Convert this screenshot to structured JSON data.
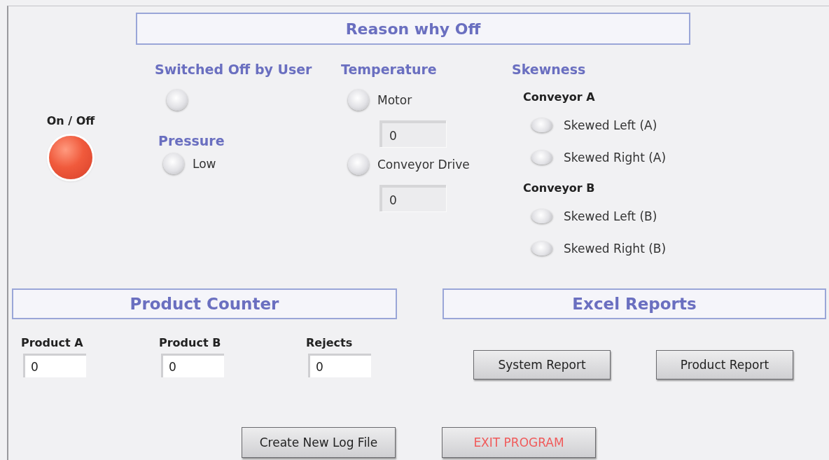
{
  "header": {
    "title": "Reason why Off"
  },
  "power": {
    "label": "On / Off",
    "on": true
  },
  "user_off": {
    "title": "Switched Off by User",
    "indicator": {
      "on": false
    }
  },
  "pressure": {
    "title": "Pressure",
    "indicators": [
      {
        "label": "Low",
        "on": false
      }
    ]
  },
  "temperature": {
    "title": "Temperature",
    "sensors": [
      {
        "label": "Motor",
        "on": false,
        "value": "0"
      },
      {
        "label": "Conveyor Drive",
        "on": false,
        "value": "0"
      }
    ]
  },
  "skewness": {
    "title": "Skewness",
    "conveyors": [
      {
        "name": "Conveyor A",
        "indicators": [
          {
            "label": "Skewed Left (A)",
            "on": false
          },
          {
            "label": "Skewed Right (A)",
            "on": false
          }
        ]
      },
      {
        "name": "Conveyor B",
        "indicators": [
          {
            "label": "Skewed Left (B)",
            "on": false
          },
          {
            "label": "Skewed Right (B)",
            "on": false
          }
        ]
      }
    ]
  },
  "product_counter": {
    "title": "Product Counter",
    "counters": [
      {
        "label": "Product A",
        "value": "0"
      },
      {
        "label": "Product B",
        "value": "0"
      },
      {
        "label": "Rejects",
        "value": "0"
      }
    ]
  },
  "excel_reports": {
    "title": "Excel Reports",
    "buttons": [
      "System Report",
      "Product Report"
    ]
  },
  "actions": [
    {
      "label": "Create New Log File",
      "kind": "normal"
    },
    {
      "label": "EXIT PROGRAM",
      "kind": "danger"
    }
  ]
}
